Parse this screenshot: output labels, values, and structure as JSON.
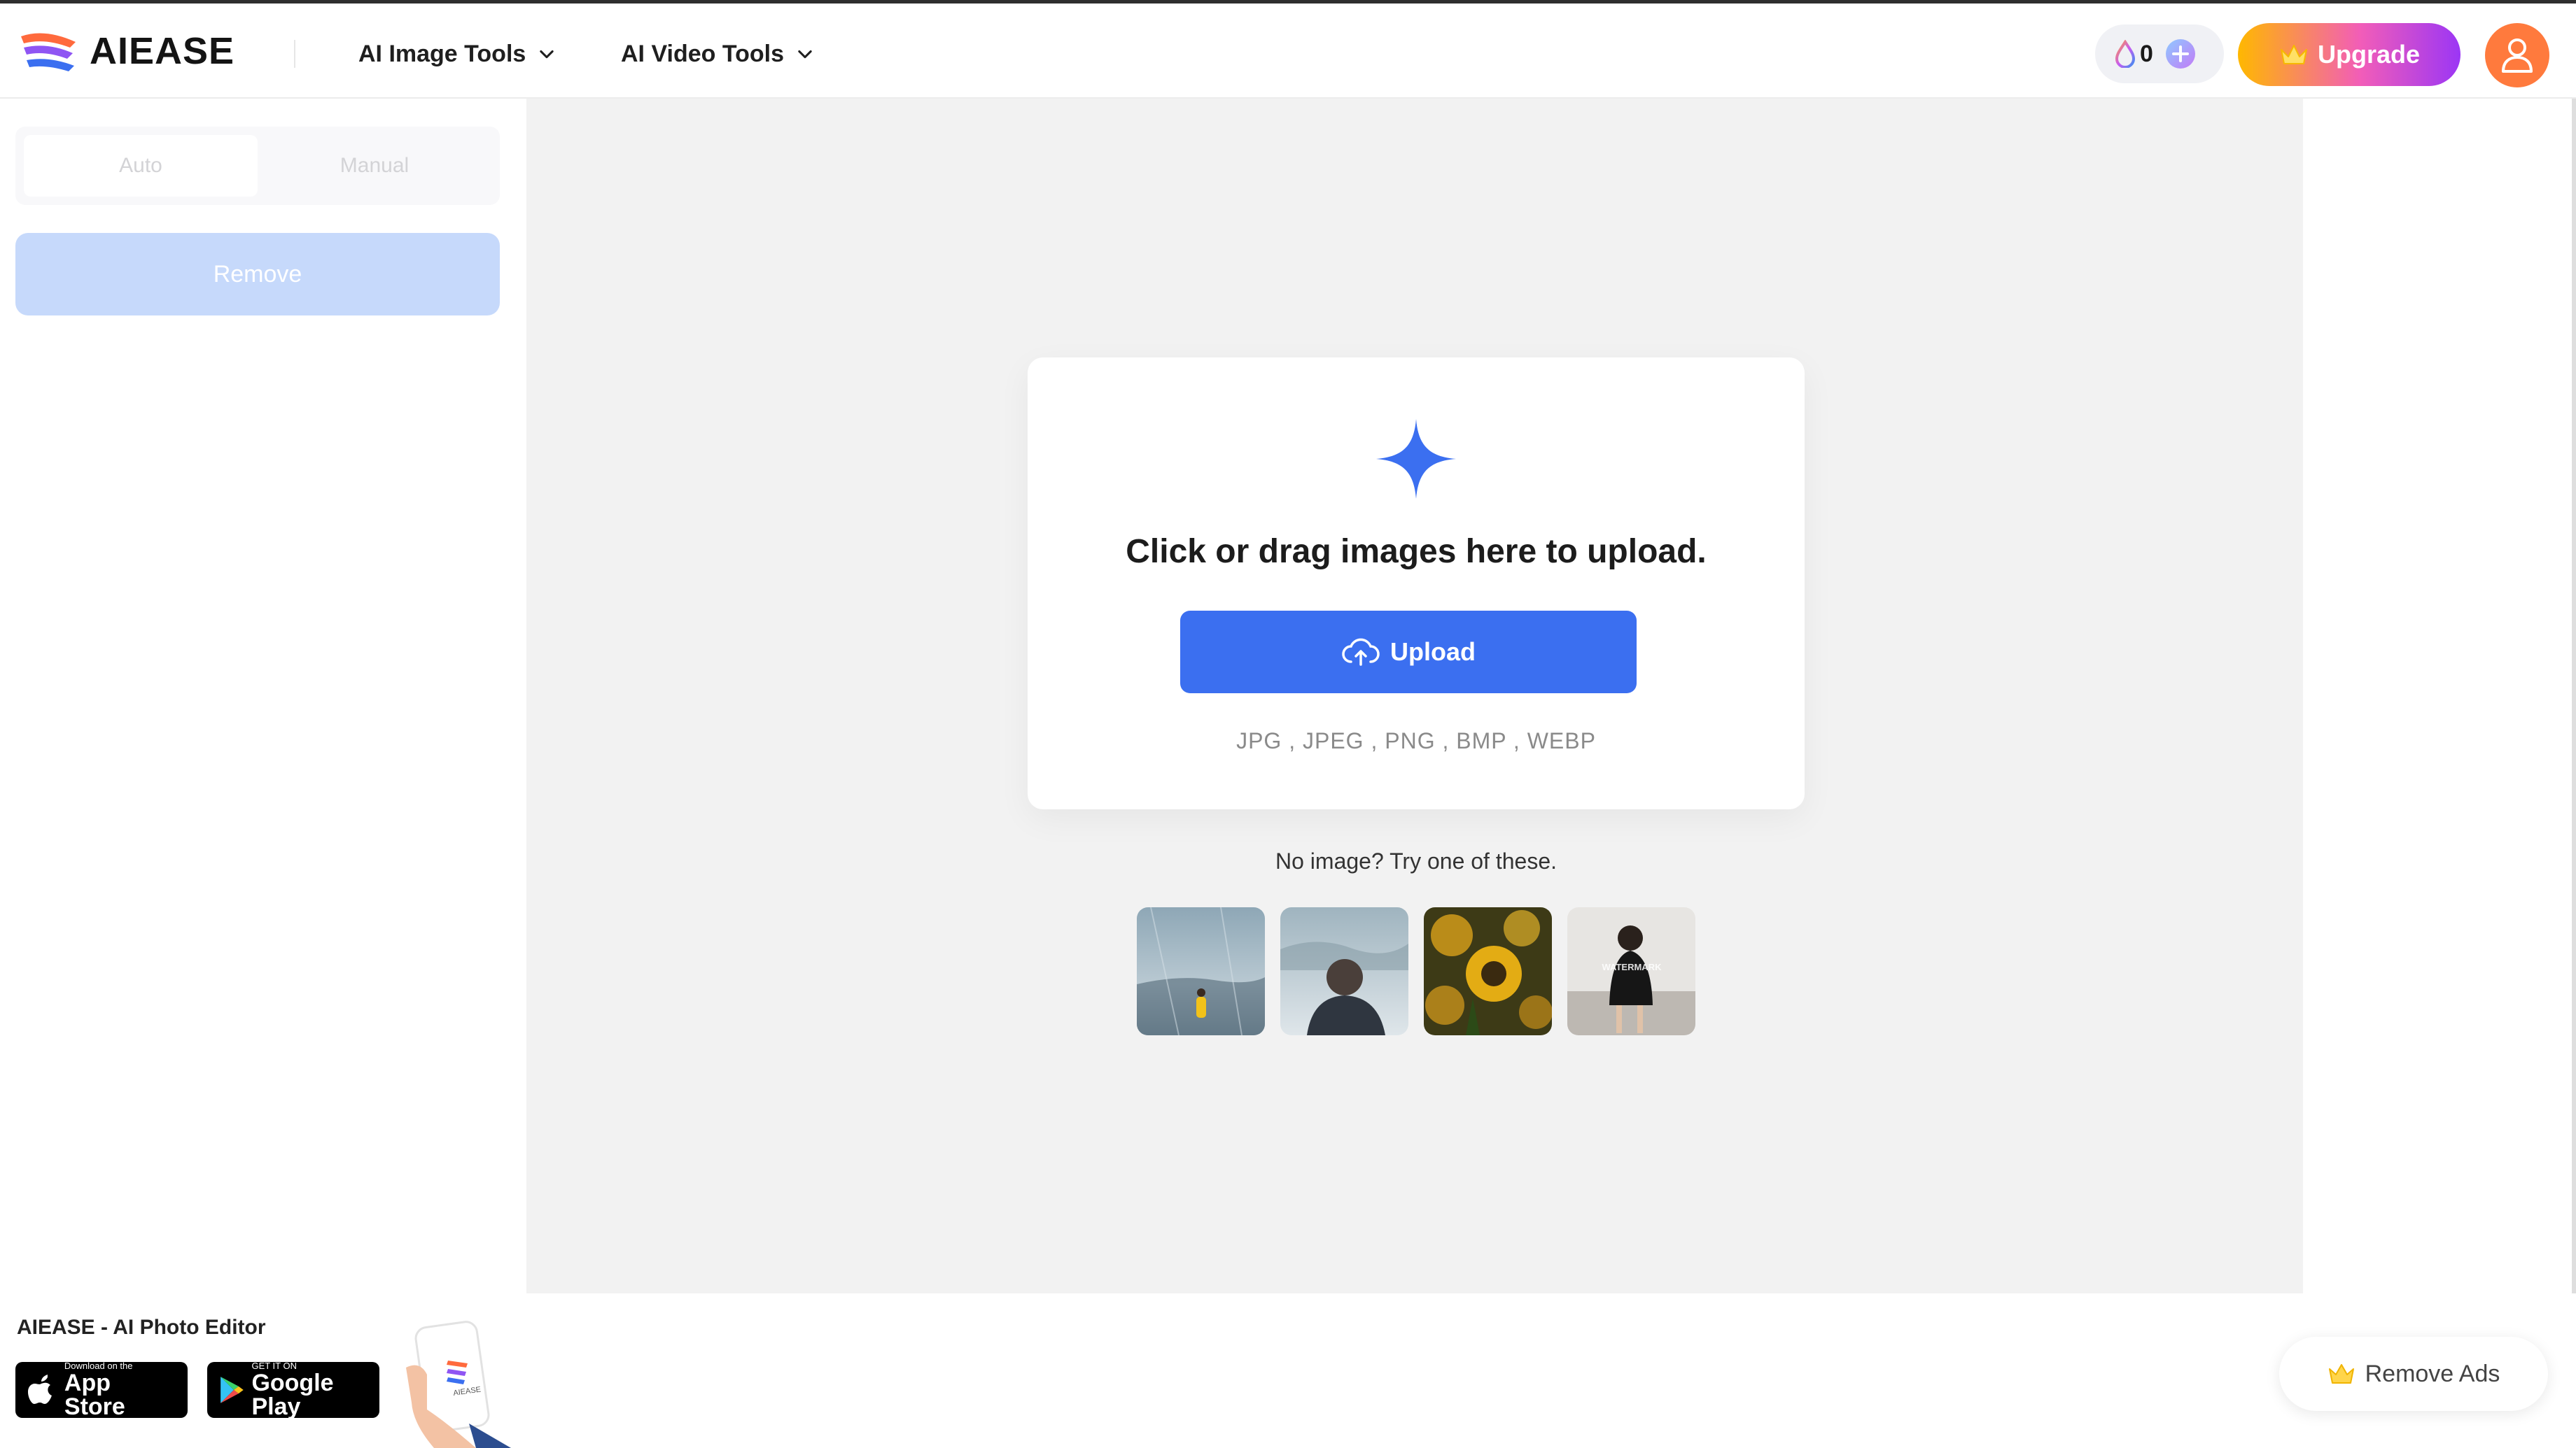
{
  "header": {
    "brand": "AIEASE",
    "nav": [
      {
        "label": "AI Image Tools",
        "icon": "chevron-down-icon"
      },
      {
        "label": "AI Video Tools",
        "icon": "chevron-down-icon"
      }
    ],
    "credits": "0",
    "upgrade_label": "Upgrade"
  },
  "sidebar": {
    "tabs": [
      {
        "label": "Auto",
        "selected": true
      },
      {
        "label": "Manual",
        "selected": false
      }
    ],
    "remove_label": "Remove"
  },
  "upload": {
    "title": "Click or drag images here to upload.",
    "button_label": "Upload",
    "formats": "JPG , JPEG , PNG , BMP , WEBP"
  },
  "samples": {
    "caption": "No image? Try one of these.",
    "items": [
      {
        "name": "misty-lake-person"
      },
      {
        "name": "snowy-person"
      },
      {
        "name": "sunflowers"
      },
      {
        "name": "woman-watermark",
        "overlay_text": "WATERMARK"
      }
    ]
  },
  "promo": {
    "title": "AIEASE - AI Photo Editor",
    "app_store": {
      "small": "Download on the",
      "big": "App Store"
    },
    "google_play": {
      "small": "GET IT ON",
      "big": "Google Play"
    },
    "phone_brand": "AIEASE"
  },
  "remove_ads_label": "Remove Ads",
  "colors": {
    "accent": "#3b6ff0",
    "disabled_blue": "#c6d9fb",
    "avatar": "#ff7a3d",
    "workarea": "#f2f2f2"
  }
}
